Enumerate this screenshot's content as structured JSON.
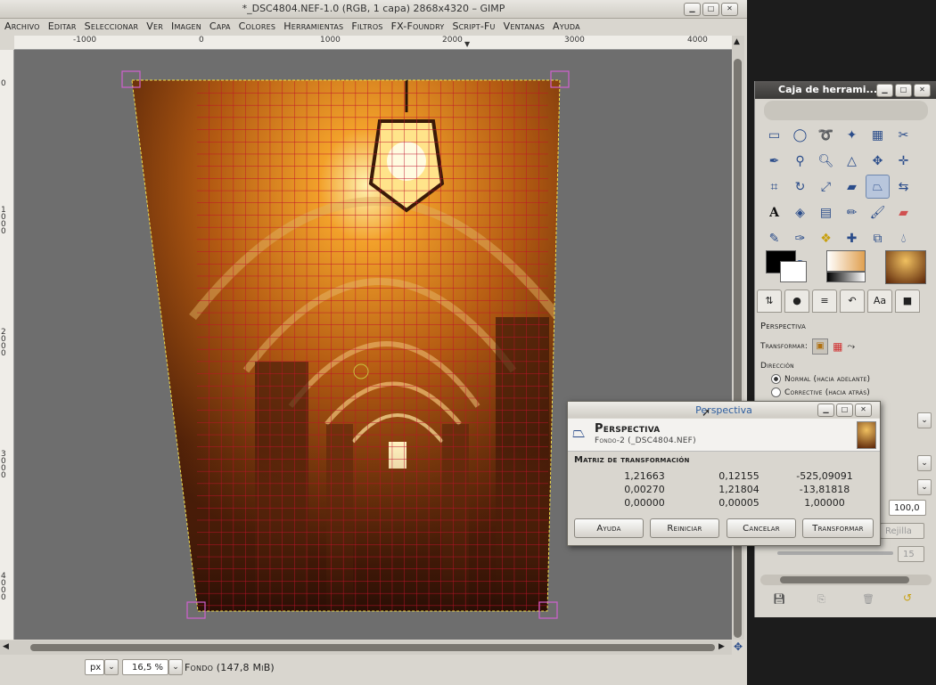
{
  "main_window": {
    "title": "*_DSC4804.NEF-1.0 (RGB, 1 capa) 2868x4320 – GIMP",
    "menu": [
      "Archivo",
      "Editar",
      "Seleccionar",
      "Ver",
      "Imagen",
      "Capa",
      "Colores",
      "Herramientas",
      "Filtros",
      "FX-Foundry",
      "Script-Fu",
      "Ventanas",
      "Ayuda"
    ],
    "ruler_h": [
      "-1000",
      "0",
      "1000",
      "2000",
      "3000",
      "4000"
    ],
    "ruler_v": [
      "0",
      "1000",
      "2000",
      "3000",
      "4000"
    ],
    "unit": "px",
    "zoom": "16,5 %",
    "status": "Fondo (147,8 MiB)"
  },
  "toolbox": {
    "title": "Caja de herrami...",
    "tool_icons": [
      "rect-select-icon",
      "ellipse-select-icon",
      "free-select-icon",
      "fuzzy-select-icon",
      "color-select-icon",
      "scissors-icon",
      "paths-icon",
      "color-picker-icon",
      "zoom-icon",
      "measure-icon",
      "move-icon",
      "align-icon",
      "crop-icon",
      "rotate-icon",
      "scale-icon",
      "shear-icon",
      "perspective-icon",
      "flip-icon",
      "text-icon",
      "bucket-fill-icon",
      "blend-icon",
      "pencil-icon",
      "paintbrush-icon",
      "eraser-icon",
      "airbrush-icon",
      "ink-icon",
      "clone-icon",
      "heal-icon",
      "perspective-clone-icon",
      "blur-icon",
      "smudge-icon",
      "dodge-icon"
    ],
    "options_title": "Perspectiva",
    "transform_label": "Transformar:",
    "direction_label": "Dirección",
    "direction_options": [
      "Normal (hacia adelante)",
      "Corrective (hacia atrás)"
    ],
    "opacity_value": "100,0",
    "grid_label": "Rejilla",
    "grid_value": "15"
  },
  "dialog": {
    "title": "Perspectiva",
    "heading": "Perspectiva",
    "subheading": "Fondo-2 (_DSC4804.NEF)",
    "matrix_label": "Matriz de transformación",
    "matrix": [
      [
        "1,21663",
        "0,12155",
        "-525,09091"
      ],
      [
        "0,00270",
        "1,21804",
        "-13,81818"
      ],
      [
        "0,00000",
        "0,00005",
        "1,00000"
      ]
    ],
    "buttons": [
      "Ayuda",
      "Reiniciar",
      "Cancelar",
      "Transformar"
    ]
  }
}
